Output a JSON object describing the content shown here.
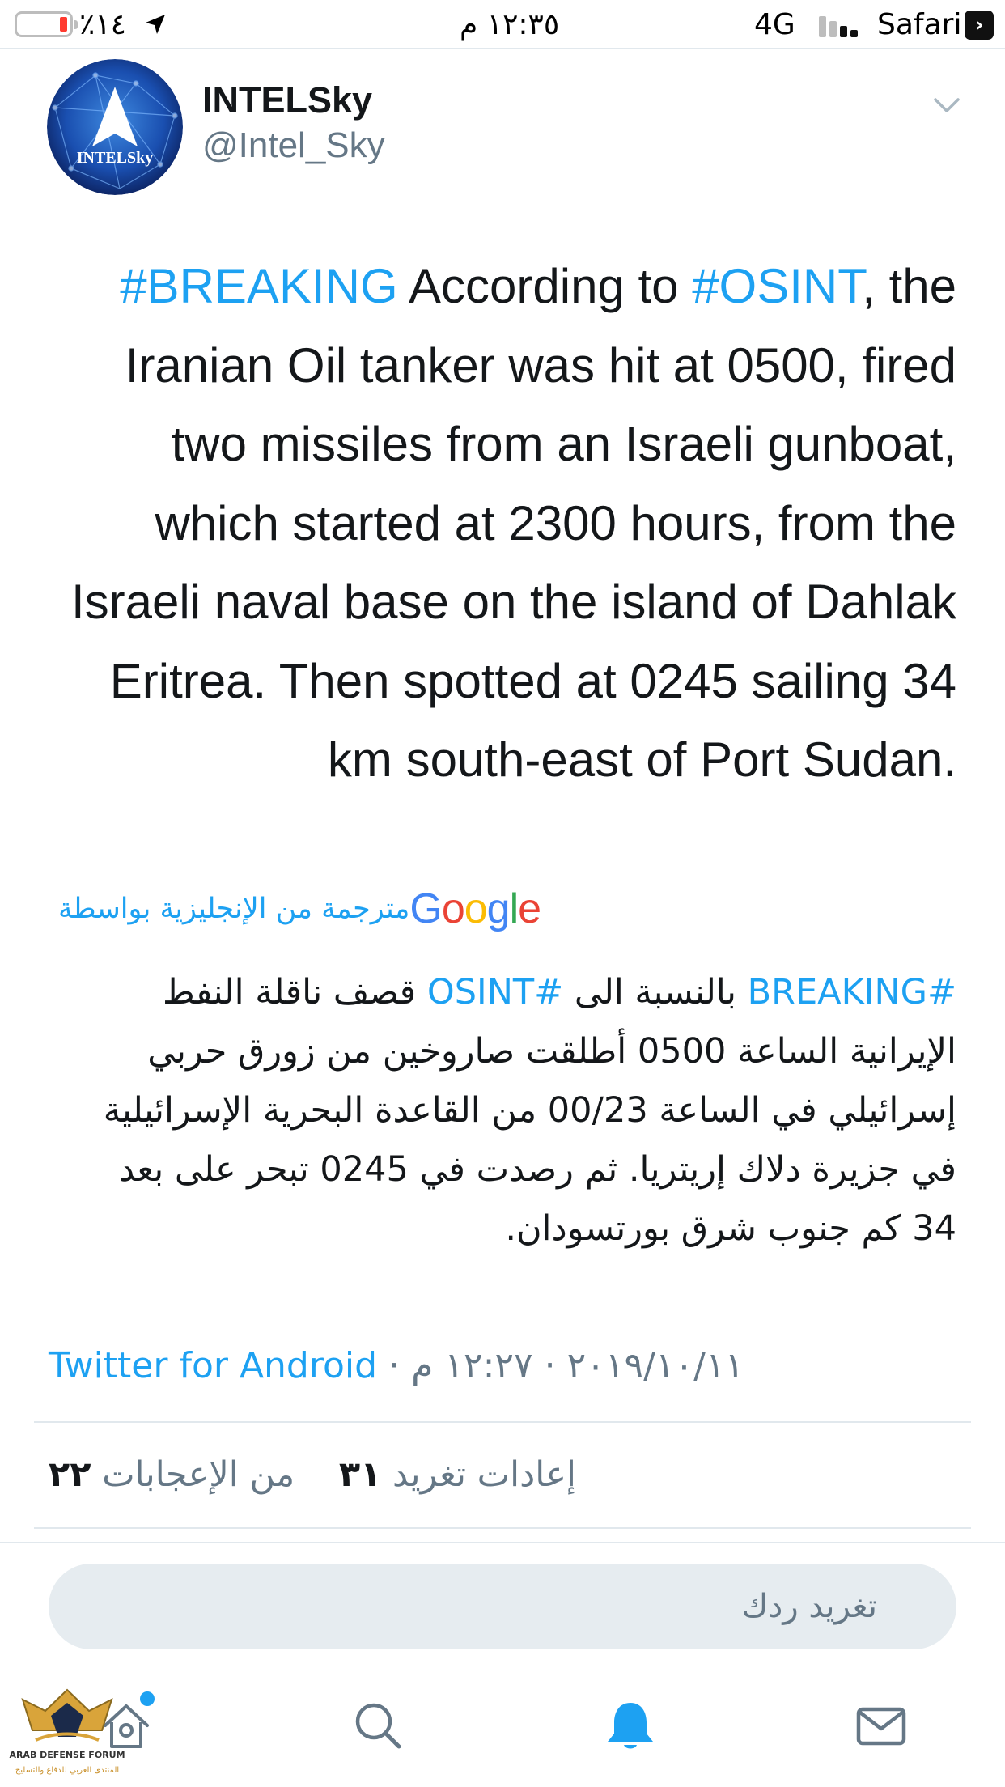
{
  "status_bar": {
    "battery": "٪١٤",
    "time": "١٢:٣٥ م",
    "network": "4G",
    "carrier_app": "Safari"
  },
  "tweet": {
    "avatar_text": "INTELSky",
    "display_name": "INTELSky",
    "handle": "@Intel_Sky",
    "text": {
      "hashtag1": "#BREAKING",
      "part1": "  According to ",
      "hashtag2": "#OSINT",
      "part2": ", the Iranian Oil tanker was hit at 0500, fired two missiles from an Israeli gunboat, which started at 2300 hours, from the Israeli naval base on the island of Dahlak Eritrea. Then spotted at 0245 sailing 34 km south-east of Port Sudan."
    },
    "translation": {
      "label": "مترجمة من الإنجليزية بواسطة",
      "provider": "Google",
      "hashtag1": "#BREAKING",
      "part1": " بالنسبة الى ",
      "hashtag2": "#OSINT",
      "part2": " قصف ناقلة النفط الإيرانية الساعة 0500 أطلقت صاروخين من زورق حربي إسرائيلي في الساعة 00/23 من القاعدة البحرية الإسرائيلية في جزيرة دلاك إريتريا. ثم رصدت في 0245 تبحر على بعد 34 كم جنوب شرق بورتسودان."
    },
    "meta": {
      "time": "١٢:٢٧ م",
      "separator": "·",
      "date": "٢٠١٩/١٠/١١",
      "source": "Twitter for Android"
    },
    "stats": {
      "likes_count": "٢٢",
      "likes_label": "من الإعجابات",
      "retweets_count": "٣١",
      "retweets_label": "إعادات تغريد"
    }
  },
  "reply": {
    "placeholder": "تغريد ردك"
  },
  "tab_bar": {
    "items": [
      {
        "icon": "home-icon"
      },
      {
        "icon": "search-icon"
      },
      {
        "icon": "notifications-icon"
      },
      {
        "icon": "messages-icon"
      }
    ]
  },
  "watermark": {
    "text_en": "ARAB DEFENSE FORUM",
    "text_ar": "المنتدى العربي للدفاع والتسليح"
  },
  "colors": {
    "accent": "#1da1f2",
    "text": "#14171a",
    "secondary": "#657786",
    "input_bg": "#e6ecf0"
  }
}
